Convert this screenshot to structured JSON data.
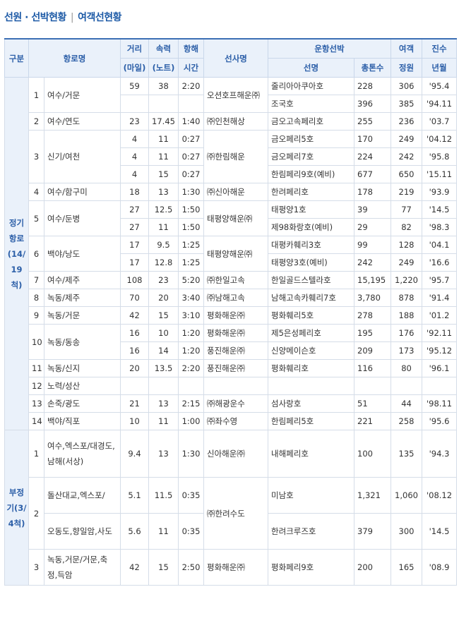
{
  "title": {
    "part1": "선원 · 선박현황",
    "separator": "|",
    "part2": "여객선현황"
  },
  "headers": {
    "category": "구분",
    "route_name": "항로명",
    "distance": "거리",
    "distance_unit": "(마일)",
    "speed": "속력",
    "speed_unit": "(노트)",
    "duration": "항해",
    "duration_unit": "시간",
    "company": "선사명",
    "operating_ships": "운항선박",
    "ship_name": "선명",
    "tonnage": "총톤수",
    "capacity": "여객",
    "capacity_unit": "정원",
    "launch": "진수",
    "launch_unit": "년월"
  },
  "categories": {
    "regular": "정기항로(14/19척)",
    "irregular": "부정기(3/4척)"
  },
  "regular_routes": [
    {
      "no": "1",
      "name": "여수/거문",
      "company": "오션호프해운㈜",
      "ships": [
        {
          "distance": "59",
          "speed": "38",
          "duration": "2:20",
          "ship": "줄리아아쿠아호",
          "tonnage": "228",
          "capacity": "306",
          "launch": "'95.4"
        },
        {
          "distance": "",
          "speed": "",
          "duration": "",
          "ship": "조국호",
          "tonnage": "396",
          "capacity": "385",
          "launch": "'94.11"
        }
      ]
    },
    {
      "no": "2",
      "name": "여수/연도",
      "company": "㈜인천해상",
      "ships": [
        {
          "distance": "23",
          "speed": "17.45",
          "duration": "1:40",
          "ship": "금오고속페리호",
          "tonnage": "255",
          "capacity": "236",
          "launch": "'03.7"
        }
      ]
    },
    {
      "no": "3",
      "name": "신기/여천",
      "company": "㈜한림해운",
      "ships": [
        {
          "distance": "4",
          "speed": "11",
          "duration": "0:27",
          "ship": "금오페리5호",
          "tonnage": "170",
          "capacity": "249",
          "launch": "'04.12"
        },
        {
          "distance": "4",
          "speed": "11",
          "duration": "0:27",
          "ship": "금오페리7호",
          "tonnage": "224",
          "capacity": "242",
          "launch": "'95.8"
        },
        {
          "distance": "4",
          "speed": "15",
          "duration": "0:27",
          "ship": "한림페리9호(예비)",
          "tonnage": "677",
          "capacity": "650",
          "launch": "'15.11"
        }
      ]
    },
    {
      "no": "4",
      "name": "여수/함구미",
      "company": "㈜신아해운",
      "ships": [
        {
          "distance": "18",
          "speed": "13",
          "duration": "1:30",
          "ship": "한려페리호",
          "tonnage": "178",
          "capacity": "219",
          "launch": "'93.9"
        }
      ]
    },
    {
      "no": "5",
      "name": "여수/둔병",
      "company": "태평양해운㈜",
      "ships": [
        {
          "distance": "27",
          "speed": "12.5",
          "duration": "1:50",
          "ship": "태평양1호",
          "tonnage": "39",
          "capacity": "77",
          "launch": "'14.5"
        },
        {
          "distance": "27",
          "speed": "11",
          "duration": "1:50",
          "ship": "제98화랑호(예비)",
          "tonnage": "29",
          "capacity": "82",
          "launch": "'98.3"
        }
      ]
    },
    {
      "no": "6",
      "name": "백야/낭도",
      "company": "태평양해운㈜",
      "ships": [
        {
          "distance": "17",
          "speed": "9.5",
          "duration": "1:25",
          "ship": "대평카훼리3호",
          "tonnage": "99",
          "capacity": "128",
          "launch": "'04.1"
        },
        {
          "distance": "17",
          "speed": "12.8",
          "duration": "1:25",
          "ship": "태평양3호(예비)",
          "tonnage": "242",
          "capacity": "249",
          "launch": "'16.6"
        }
      ]
    },
    {
      "no": "7",
      "name": "여수/제주",
      "company": "㈜한일고속",
      "ships": [
        {
          "distance": "108",
          "speed": "23",
          "duration": "5:20",
          "ship": "한일골드스텔라호",
          "tonnage": "15,195",
          "capacity": "1,220",
          "launch": "'95.7"
        }
      ]
    },
    {
      "no": "8",
      "name": "녹동/제주",
      "company": "㈜남해고속",
      "ships": [
        {
          "distance": "70",
          "speed": "20",
          "duration": "3:40",
          "ship": "남해고속카훼리7호",
          "tonnage": "3,780",
          "capacity": "878",
          "launch": "'91.4"
        }
      ]
    },
    {
      "no": "9",
      "name": "녹동/거문",
      "company": "평화해운㈜",
      "ships": [
        {
          "distance": "42",
          "speed": "15",
          "duration": "3:10",
          "ship": "평화훼리5호",
          "tonnage": "278",
          "capacity": "188",
          "launch": "'01.2"
        }
      ]
    },
    {
      "no": "10",
      "name": "녹동/동송",
      "company": "",
      "ships": [
        {
          "distance": "16",
          "speed": "10",
          "duration": "1:20",
          "company": "평화해운㈜",
          "ship": "제5은성페리호",
          "tonnage": "195",
          "capacity": "176",
          "launch": "'92.11"
        },
        {
          "distance": "16",
          "speed": "14",
          "duration": "1:20",
          "company": "풍진해운㈜",
          "ship": "신양메이슨호",
          "tonnage": "209",
          "capacity": "173",
          "launch": "'95.12"
        }
      ]
    },
    {
      "no": "11",
      "name": "녹동/신지",
      "company": "풍진해운㈜",
      "ships": [
        {
          "distance": "20",
          "speed": "13.5",
          "duration": "2:20",
          "ship": "평화훼리호",
          "tonnage": "116",
          "capacity": "80",
          "launch": "'96.1"
        }
      ]
    },
    {
      "no": "12",
      "name": "노력/성산",
      "company": "",
      "ships": [
        {
          "distance": "",
          "speed": "",
          "duration": "",
          "ship": "",
          "tonnage": "",
          "capacity": "",
          "launch": ""
        }
      ]
    },
    {
      "no": "13",
      "name": "손죽/광도",
      "company": "㈜해광운수",
      "ships": [
        {
          "distance": "21",
          "speed": "13",
          "duration": "2:15",
          "ship": "섬사랑호",
          "tonnage": "51",
          "capacity": "44",
          "launch": "'98.11"
        }
      ]
    },
    {
      "no": "14",
      "name": "백야/직포",
      "company": "㈜좌수영",
      "ships": [
        {
          "distance": "10",
          "speed": "11",
          "duration": "1:00",
          "ship": "한림페리5호",
          "tonnage": "221",
          "capacity": "258",
          "launch": "'95.6"
        }
      ]
    }
  ],
  "irregular_routes": [
    {
      "no": "1",
      "name": "여수,엑스포/대경도,남해(서상)",
      "company": "신아해운㈜",
      "ships": [
        {
          "distance": "9.4",
          "speed": "13",
          "duration": "1:30",
          "ship": "내해페리호",
          "tonnage": "100",
          "capacity": "135",
          "launch": "'94.3"
        }
      ]
    },
    {
      "no": "2",
      "name": "",
      "company": "㈜한려수도",
      "ships": [
        {
          "route": "돌산대교,엑스포/",
          "distance": "5.1",
          "speed": "11.5",
          "duration": "0:35",
          "ship": "미남호",
          "tonnage": "1,321",
          "capacity": "1,060",
          "launch": "'08.12"
        },
        {
          "route": "오동도,향일암,사도",
          "distance": "5.6",
          "speed": "11",
          "duration": "0:35",
          "ship": "한려크루즈호",
          "tonnage": "379",
          "capacity": "300",
          "launch": "'14.5"
        }
      ]
    },
    {
      "no": "3",
      "name": "녹동,거문/거문,축정,득암",
      "company": "평화해운㈜",
      "ships": [
        {
          "distance": "42",
          "speed": "15",
          "duration": "2:50",
          "ship": "평화페리9호",
          "tonnage": "200",
          "capacity": "165",
          "launch": "'08.9"
        }
      ]
    }
  ]
}
